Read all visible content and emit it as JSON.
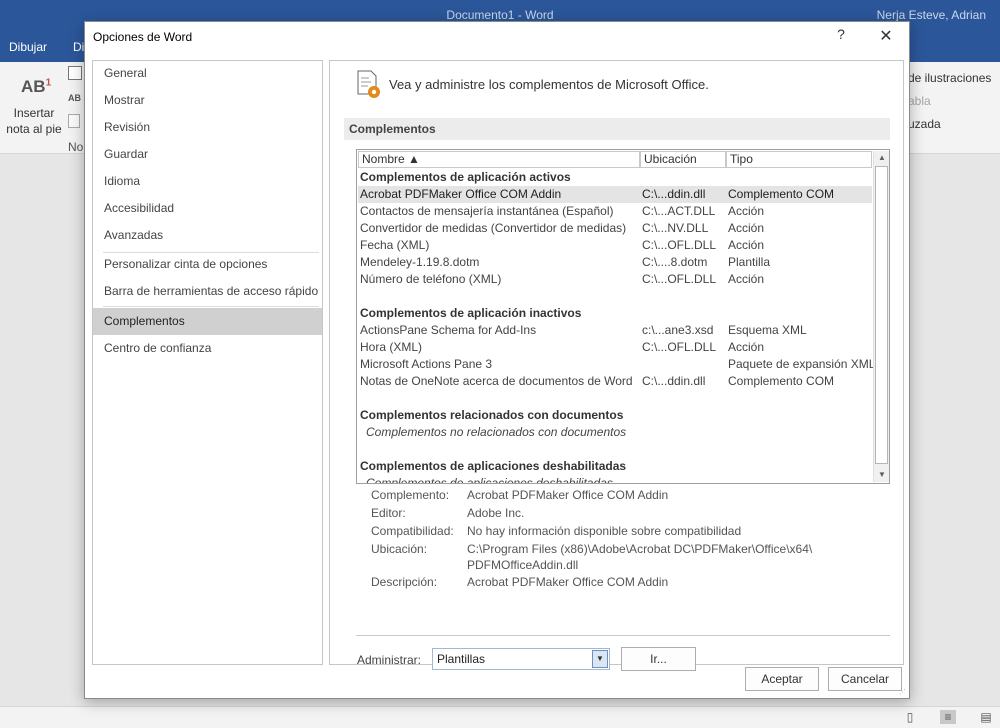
{
  "word": {
    "doc_title": "Documento1  -  Word",
    "user": "Nerja Esteve, Adrian",
    "tabs": [
      "Dibujar",
      "Di"
    ],
    "ribbon": {
      "ab_text": "AB",
      "ab_sup": "1",
      "insert_footnote": "Insertar nota al pie",
      "no_label": "No",
      "ab_small": "AB",
      "right_1": "de ilustraciones",
      "right_2": "abla",
      "right_3": "uzada"
    }
  },
  "dialog": {
    "title": "Opciones de Word",
    "help": "?",
    "close": "✕",
    "nav": [
      "General",
      "Mostrar",
      "Revisión",
      "Guardar",
      "Idioma",
      "Accesibilidad",
      "Avanzadas",
      "Personalizar cinta de opciones",
      "Barra de herramientas de acceso rápido",
      "Complementos",
      "Centro de confianza"
    ],
    "nav_selected": "Complementos",
    "header_text": "Vea y administre los complementos de Microsoft Office.",
    "section_title": "Complementos",
    "columns": {
      "name": "Nombre ▲",
      "location": "Ubicación",
      "type": "Tipo"
    },
    "groups": [
      {
        "title": "Complementos de aplicación activos",
        "items": [
          {
            "name": "Acrobat PDFMaker Office COM Addin",
            "location": "C:\\...ddin.dll",
            "type": "Complemento COM"
          },
          {
            "name": "Contactos de mensajería instantánea (Español)",
            "location": "C:\\...ACT.DLL",
            "type": "Acción"
          },
          {
            "name": "Convertidor de medidas (Convertidor de medidas)",
            "location": "C:\\...NV.DLL",
            "type": "Acción"
          },
          {
            "name": "Fecha (XML)",
            "location": "C:\\...OFL.DLL",
            "type": "Acción"
          },
          {
            "name": "Mendeley-1.19.8.dotm",
            "location": "C:\\....8.dotm",
            "type": "Plantilla"
          },
          {
            "name": "Número de teléfono (XML)",
            "location": "C:\\...OFL.DLL",
            "type": "Acción"
          }
        ]
      },
      {
        "title": "Complementos de aplicación inactivos",
        "items": [
          {
            "name": "ActionsPane Schema for Add-Ins",
            "location": "c:\\...ane3.xsd",
            "type": "Esquema XML"
          },
          {
            "name": "Hora (XML)",
            "location": "C:\\...OFL.DLL",
            "type": "Acción"
          },
          {
            "name": "Microsoft Actions Pane 3",
            "location": "",
            "type": "Paquete de expansión XML"
          },
          {
            "name": "Notas de OneNote acerca de documentos de Word",
            "location": "C:\\...ddin.dll",
            "type": "Complemento COM"
          }
        ]
      },
      {
        "title": "Complementos relacionados con documentos",
        "empty": "Complementos no relacionados con documentos"
      },
      {
        "title": "Complementos de aplicaciones deshabilitadas",
        "empty": "Complementos de aplicaciones deshabilitadas"
      }
    ],
    "details": {
      "addin_label": "Complemento:",
      "addin_value": "Acrobat PDFMaker Office COM Addin",
      "publisher_label": "Editor:",
      "publisher_value": "Adobe Inc.",
      "compat_label": "Compatibilidad:",
      "compat_value": "No hay información disponible sobre compatibilidad",
      "location_label": "Ubicación:",
      "location_value_1": "C:\\Program Files (x86)\\Adobe\\Acrobat DC\\PDFMaker\\Office\\x64\\",
      "location_value_2": "PDFMOfficeAddin.dll",
      "desc_label": "Descripción:",
      "desc_value": "Acrobat PDFMaker Office COM Addin"
    },
    "manage_label": "Administrar:",
    "manage_value": "Plantillas",
    "go_button": "Ir...",
    "ok_button": "Aceptar",
    "cancel_button": "Cancelar"
  }
}
